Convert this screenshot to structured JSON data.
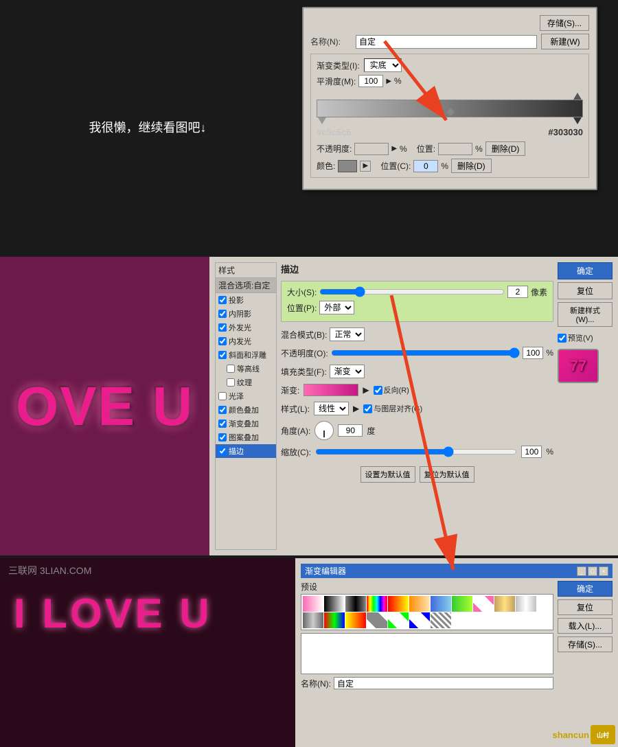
{
  "section1": {
    "lazy_text": "我很懒，继续看图吧↓",
    "dialog": {
      "save_btn": "存储(S)...",
      "name_label": "名称(N):",
      "name_value": "自定",
      "new_btn": "新建(W)",
      "gradient_type_label": "渐变类型(I):",
      "gradient_type_value": "实底",
      "smooth_label": "平滑度(M):",
      "smooth_value": "100",
      "smooth_unit": "%",
      "color_left": "#c5c5c5",
      "color_right": "#303030",
      "opacity_label": "不透明度:",
      "opacity_unit": "%",
      "location_label": "位置:",
      "location_unit": "%",
      "delete_btn": "删除(D)",
      "color_label": "颜色:",
      "location2_label": "位置(C):",
      "location2_value": "0",
      "location2_unit": "%",
      "delete2_btn": "删除(D)"
    }
  },
  "section2": {
    "love_text": "OVE U",
    "style_dialog": {
      "title": "样式",
      "blend_option": "混合选项:自定",
      "items": [
        {
          "label": "投影",
          "checked": true
        },
        {
          "label": "内阴影",
          "checked": true
        },
        {
          "label": "外发光",
          "checked": true
        },
        {
          "label": "内发光",
          "checked": true
        },
        {
          "label": "斜面和浮雕",
          "checked": true
        },
        {
          "label": "等高线",
          "checked": false
        },
        {
          "label": "纹理",
          "checked": false
        },
        {
          "label": "光泽",
          "checked": false
        },
        {
          "label": "颜色叠加",
          "checked": true
        },
        {
          "label": "渐变叠加",
          "checked": true
        },
        {
          "label": "图案叠加",
          "checked": true
        },
        {
          "label": "描边",
          "checked": true,
          "active": true
        }
      ],
      "stroke_section": {
        "title": "描边",
        "size_label": "大小(S):",
        "size_value": "2",
        "size_unit": "像素",
        "position_label": "位置(P):",
        "position_value": "外部",
        "blend_label": "混合模式(B):",
        "blend_value": "正常",
        "opacity_label": "不透明度(O):",
        "opacity_value": "100",
        "opacity_unit": "%",
        "fill_type_label": "填充类型(F):",
        "fill_type_value": "渐变",
        "gradient_label": "渐变:",
        "reverse_label": "反向(R)",
        "style_label": "样式(L):",
        "style_value": "线性",
        "align_label": "与图层对齐(G)",
        "angle_label": "角度(A):",
        "angle_value": "90",
        "angle_unit": "度",
        "scale_label": "缩放(C):",
        "scale_value": "100",
        "scale_unit": "%",
        "set_default_btn": "设置为默认值",
        "reset_default_btn": "复位为默认值"
      },
      "ok_btn": "确定",
      "cancel_btn": "复位",
      "new_style_btn": "新建样式(W)...",
      "preview_label": "预览(V)"
    }
  },
  "section3": {
    "watermark": "三联网 3LIAN.COM",
    "love_text": "I LOVE U",
    "gradient_editor": {
      "title": "渐变编辑器",
      "preset_label": "预设",
      "name_label": "名称(N):",
      "name_value": "自定",
      "ok_btn": "确定",
      "cancel_btn": "复位",
      "load_btn": "载入(L)...",
      "save_btn": "存储(S)..."
    },
    "shancun": {
      "text": "shancun",
      "logo": "山村"
    }
  }
}
